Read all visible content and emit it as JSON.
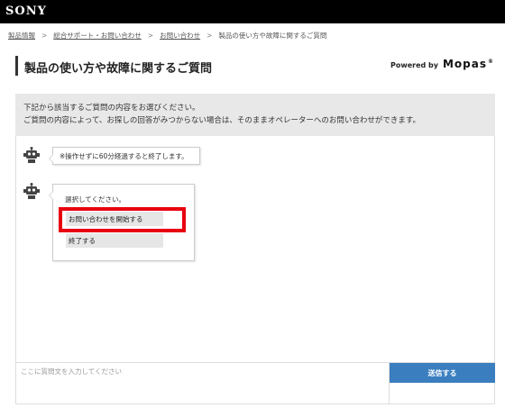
{
  "header": {
    "logo": "SONY"
  },
  "breadcrumb": [
    "製品情報",
    "総合サポート・お問い合わせ",
    "お問い合わせ",
    "製品の使い方や故障に関するご質問"
  ],
  "page": {
    "title": "製品の使い方や故障に関するご質問",
    "powered_by": "Powered by",
    "brand": "Mopas",
    "brand_mark": "®"
  },
  "info": {
    "line1": "下記から該当するご質問の内容をお選びください。",
    "line2": "ご質問の内容によって、お探しの回答がみつからない場合は、そのままオペレーターへのお問い合わせができます。"
  },
  "chat": {
    "message1": "※操作せずに60分経過すると終了します。",
    "prompt": "選択してください。",
    "options": [
      "お問い合わせを開始する",
      "終了する"
    ]
  },
  "input": {
    "placeholder": "ここに質問文を入力してください",
    "send_label": "送信する"
  },
  "colors": {
    "accent": "#3a7ebf",
    "highlight": "#e8000f",
    "topbar": "#000000"
  }
}
